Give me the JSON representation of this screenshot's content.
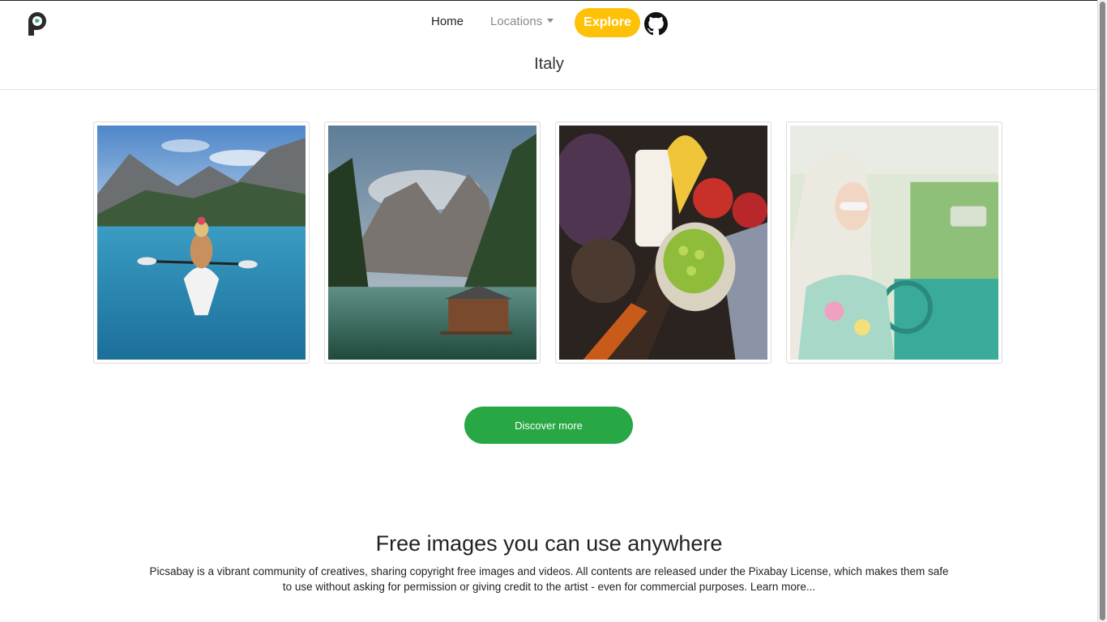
{
  "nav": {
    "home": "Home",
    "locations": "Locations",
    "explore": "Explore"
  },
  "page": {
    "subtitle": "Italy"
  },
  "gallery": {
    "images": [
      {
        "name": "kayak-lake-image"
      },
      {
        "name": "mountain-lake-cabin-image"
      },
      {
        "name": "fruit-milk-image"
      },
      {
        "name": "woman-vintage-car-image"
      }
    ]
  },
  "actions": {
    "discover": "Discover more"
  },
  "footer": {
    "title": "Free images you can use anywhere",
    "text": "Picsabay is a vibrant community of creatives, sharing copyright free images and videos. All contents are released under the Pixabay License, which makes them safe to use without asking for permission or giving credit to the artist - even for commercial purposes. Learn more..."
  },
  "colors": {
    "explore": "#ffc107",
    "discover": "#28a745"
  },
  "icons": [
    "app-logo-icon",
    "github-icon",
    "chevron-down-icon"
  ]
}
